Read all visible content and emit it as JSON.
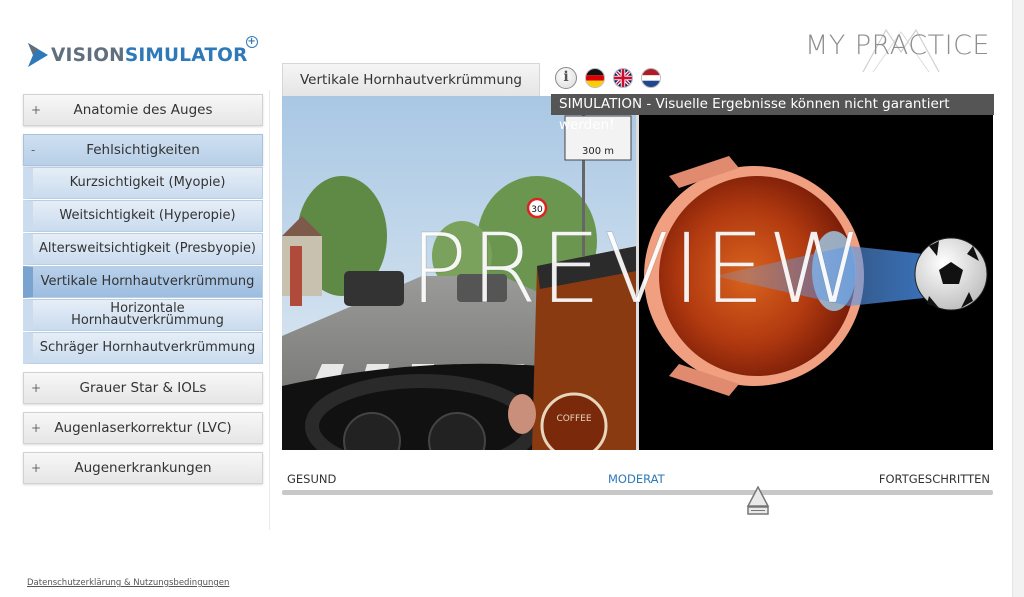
{
  "logo": {
    "part1": "VISION",
    "part2": "SIMULATOR",
    "plus": "+"
  },
  "brand": "MY PRACTICE",
  "tab_title": "Vertikale Hornhautverkrümmung",
  "icons": {
    "info": "i",
    "languages": [
      "german-flag-icon",
      "uk-flag-icon",
      "dutch-flag-icon"
    ]
  },
  "warning": "SIMULATION - Visuelle Ergebnisse können nicht garantiert werden!",
  "watermark": "PREVIEW",
  "sidebar": {
    "categories": [
      {
        "sign": "+",
        "label": "Anatomie des Auges"
      },
      {
        "sign": "-",
        "label": "Fehlsichtigkeiten"
      },
      {
        "sign": "+",
        "label": "Grauer Star & IOLs"
      },
      {
        "sign": "+",
        "label": "Augenlaserkorrektur (LVC)"
      },
      {
        "sign": "+",
        "label": "Augenerkrankungen"
      }
    ],
    "subitems": [
      {
        "label": "Kurzsichtigkeit (Myopie)"
      },
      {
        "label": "Weitsichtigkeit (Hyperopie)"
      },
      {
        "label": "Altersweitsichtigkeit (Presbyopie)"
      },
      {
        "label": "Vertikale Hornhautverkrümmung"
      },
      {
        "label": "Horizontale Hornhautverkrümmung"
      },
      {
        "label": "Schräger Hornhautverkrümmung"
      }
    ]
  },
  "scene": {
    "sign_distance": "300 m",
    "speed_sign": "30",
    "cup_text": "COFFEE"
  },
  "slider": {
    "labels": [
      "GESUND",
      "MODERAT",
      "FORTGESCHRITTEN"
    ],
    "selected": "MODERAT",
    "position": 0.67
  },
  "footer": "Datenschutzerklärung & Nutzungsbedingungen",
  "colors": {
    "accent": "#2f79b9",
    "logo_grey": "#5f6f7e",
    "active_item": "#9dbde0"
  }
}
